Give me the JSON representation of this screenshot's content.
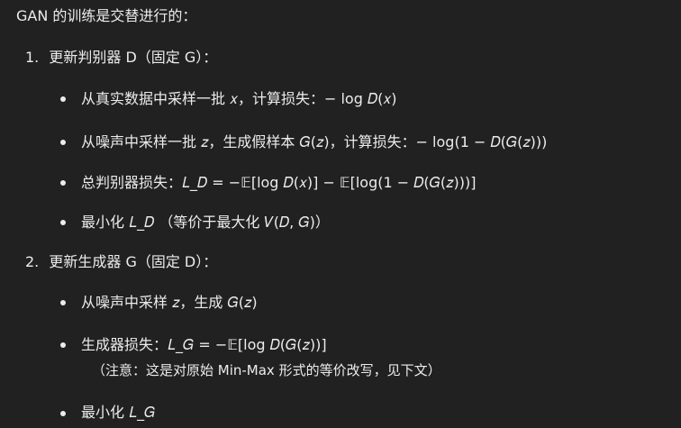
{
  "content": {
    "intro": "GAN 的训练是交替进行的：",
    "steps": [
      {
        "number": "1.",
        "title": "更新判别器 D（固定 G）：",
        "items": [
          {
            "text": "从真实数据中采样一批 𝑥，计算损失：− log 𝐷(𝑥)"
          },
          {
            "text": "从噪声中采样一批 𝑧，生成假样本 𝐺(𝑧)，计算损失：− log(1 − 𝐷(𝐺(𝑧)))"
          },
          {
            "text": "总判别器损失：𝐿_𝐷 = −𝔼[log 𝐷(𝑥)] − 𝔼[log(1 − 𝐷(𝐺(𝑧)))]"
          },
          {
            "text": "最小化 𝐿_𝐷 （等价于最大化 𝑉(𝐷, 𝐺)）"
          }
        ]
      },
      {
        "number": "2.",
        "title": "更新生成器 G（固定 D）：",
        "items": [
          {
            "text": "从噪声中采样 𝑧，生成 𝐺(𝑧)"
          },
          {
            "text": "生成器损失：𝐿_𝐺 = −𝔼[log 𝐷(𝐺(𝑧))]",
            "note": "（注意：这是对原始 Min-Max 形式的等价改写，见下文）"
          },
          {
            "text": "最小化 𝐿_𝐺"
          }
        ]
      }
    ]
  }
}
